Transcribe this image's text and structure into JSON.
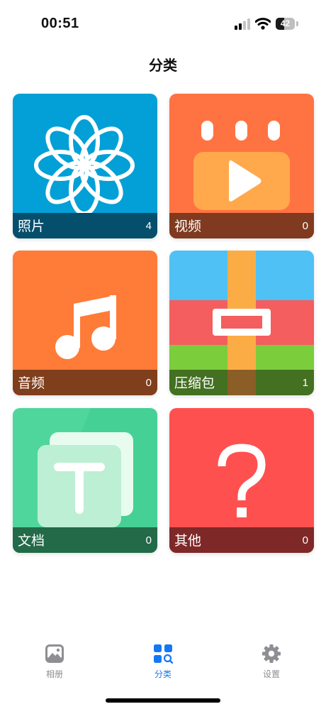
{
  "status": {
    "time": "00:51",
    "battery": "42"
  },
  "title": "分类",
  "categories": [
    {
      "name": "照片",
      "count": "4",
      "icon": "flower-icon"
    },
    {
      "name": "视频",
      "count": "0",
      "icon": "video-play-icon"
    },
    {
      "name": "音频",
      "count": "0",
      "icon": "music-note-icon"
    },
    {
      "name": "压缩包",
      "count": "1",
      "icon": "archive-icon"
    },
    {
      "name": "文档",
      "count": "0",
      "icon": "text-document-icon"
    },
    {
      "name": "其他",
      "count": "0",
      "icon": "question-mark-icon"
    }
  ],
  "tabs": [
    {
      "label": "相册",
      "icon": "album-icon",
      "active": false
    },
    {
      "label": "分类",
      "icon": "category-icon",
      "active": true
    },
    {
      "label": "设置",
      "icon": "gear-icon",
      "active": false
    }
  ],
  "colors": {
    "photo": "#02a0d6",
    "video": "#ff7342",
    "audio": "#ff7b38",
    "other": "#ff5050",
    "doc": "#4fd69c",
    "accent": "#1478f5"
  }
}
